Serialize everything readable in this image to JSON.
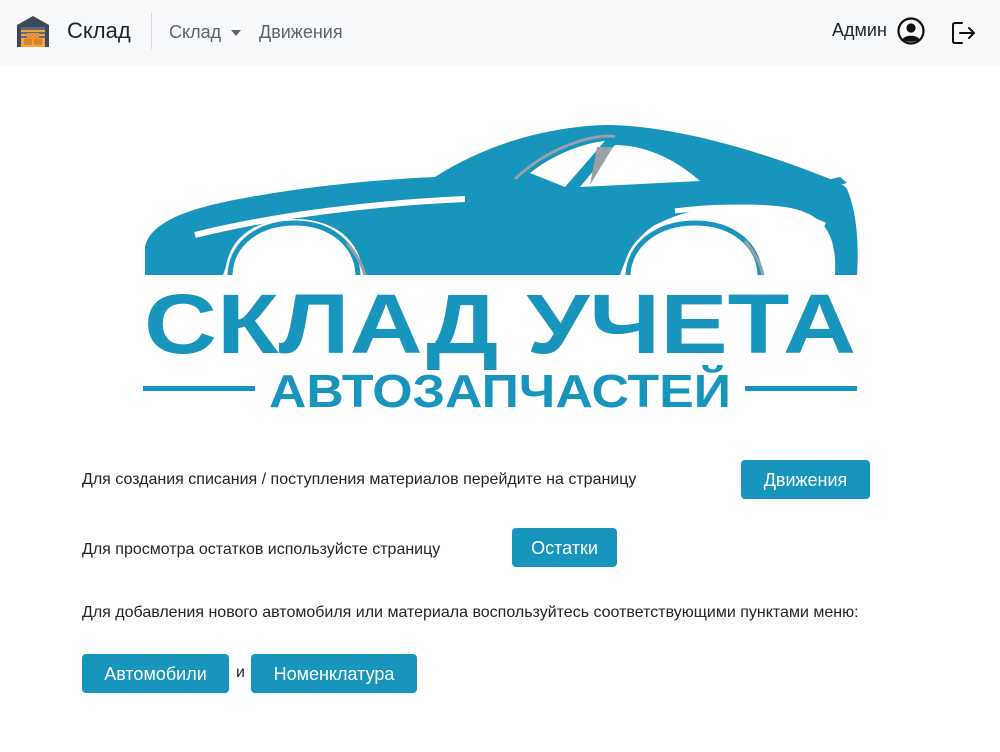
{
  "navbar": {
    "brand": "Склад",
    "links": {
      "sklad": "Склад",
      "moves": "Движения"
    },
    "user": "Админ",
    "brand_icon": "warehouse-icon",
    "user_icon": "user-circle-icon",
    "logout_icon": "logout-icon"
  },
  "logo": {
    "line1": "СКЛАД УЧЕТА",
    "line2": "АВТОЗАПЧАСТЕЙ",
    "color": "#1795bd"
  },
  "content": {
    "line1": "Для создания списания / поступления материалов перейдите на страницу",
    "line1_button": "Движения",
    "line2": "Для просмотра остатков используйсте страницу",
    "line2_button": "Остатки",
    "line3": "Для добавления нового автомобиля или материала воспользуйтесь соответствующими пунктами меню:",
    "button_cars": "Автомобили",
    "conjunction": "и",
    "button_nomenclature": "Номенклатура"
  },
  "colors": {
    "accent": "#1795bd",
    "navbar_bg": "#f8f9fa"
  }
}
